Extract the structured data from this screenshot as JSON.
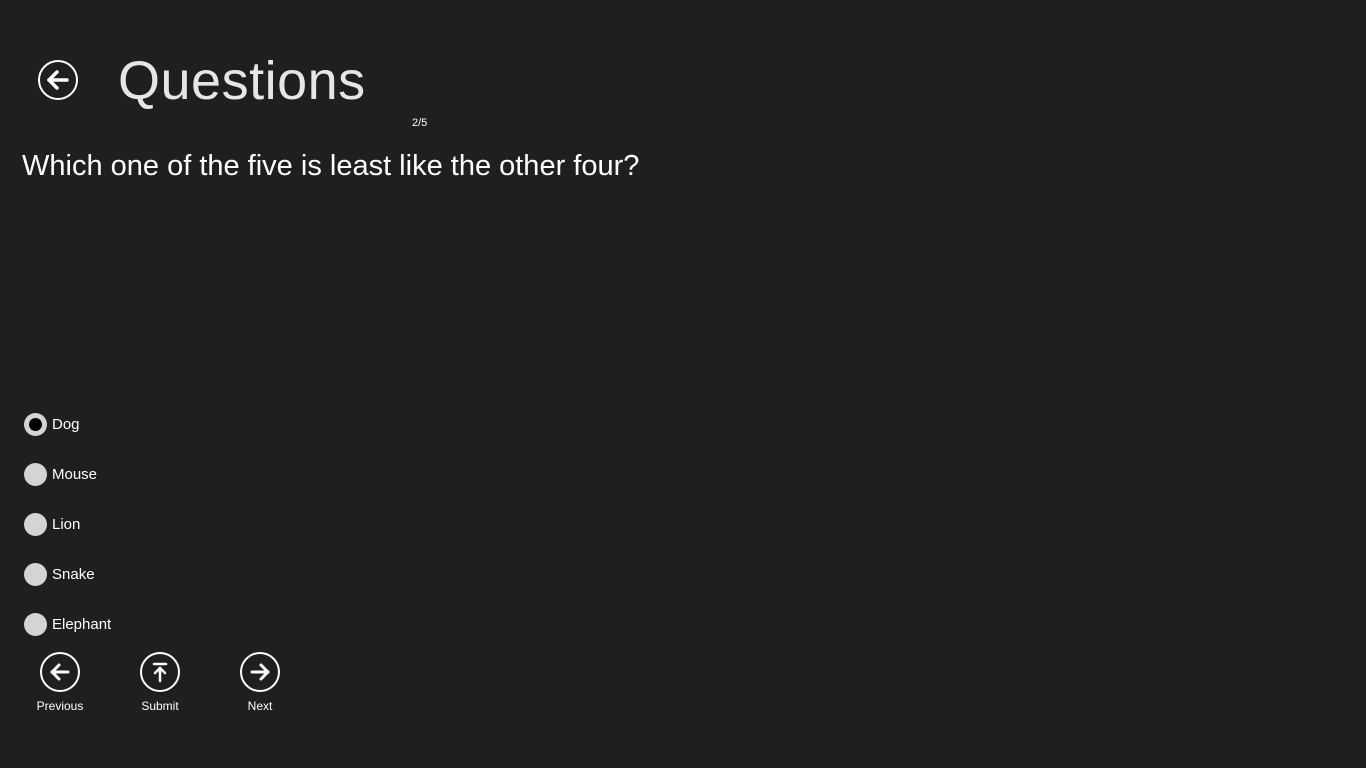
{
  "header": {
    "title": "Questions",
    "back_icon": "back-arrow-icon"
  },
  "progress": {
    "text": "2/5",
    "current": 2,
    "total": 5
  },
  "question": {
    "text": "Which one of the five is least like the other four?"
  },
  "options": [
    {
      "label": "Dog",
      "selected": true
    },
    {
      "label": "Mouse",
      "selected": false
    },
    {
      "label": "Lion",
      "selected": false
    },
    {
      "label": "Snake",
      "selected": false
    },
    {
      "label": "Elephant",
      "selected": false
    }
  ],
  "app_bar": {
    "previous": {
      "label": "Previous",
      "icon": "left-arrow-icon"
    },
    "submit": {
      "label": "Submit",
      "icon": "upload-icon"
    },
    "next": {
      "label": "Next",
      "icon": "right-arrow-icon"
    }
  },
  "colors": {
    "background": "#1f1f1f",
    "text": "#ffffff",
    "radio": "#d4d4d4"
  }
}
